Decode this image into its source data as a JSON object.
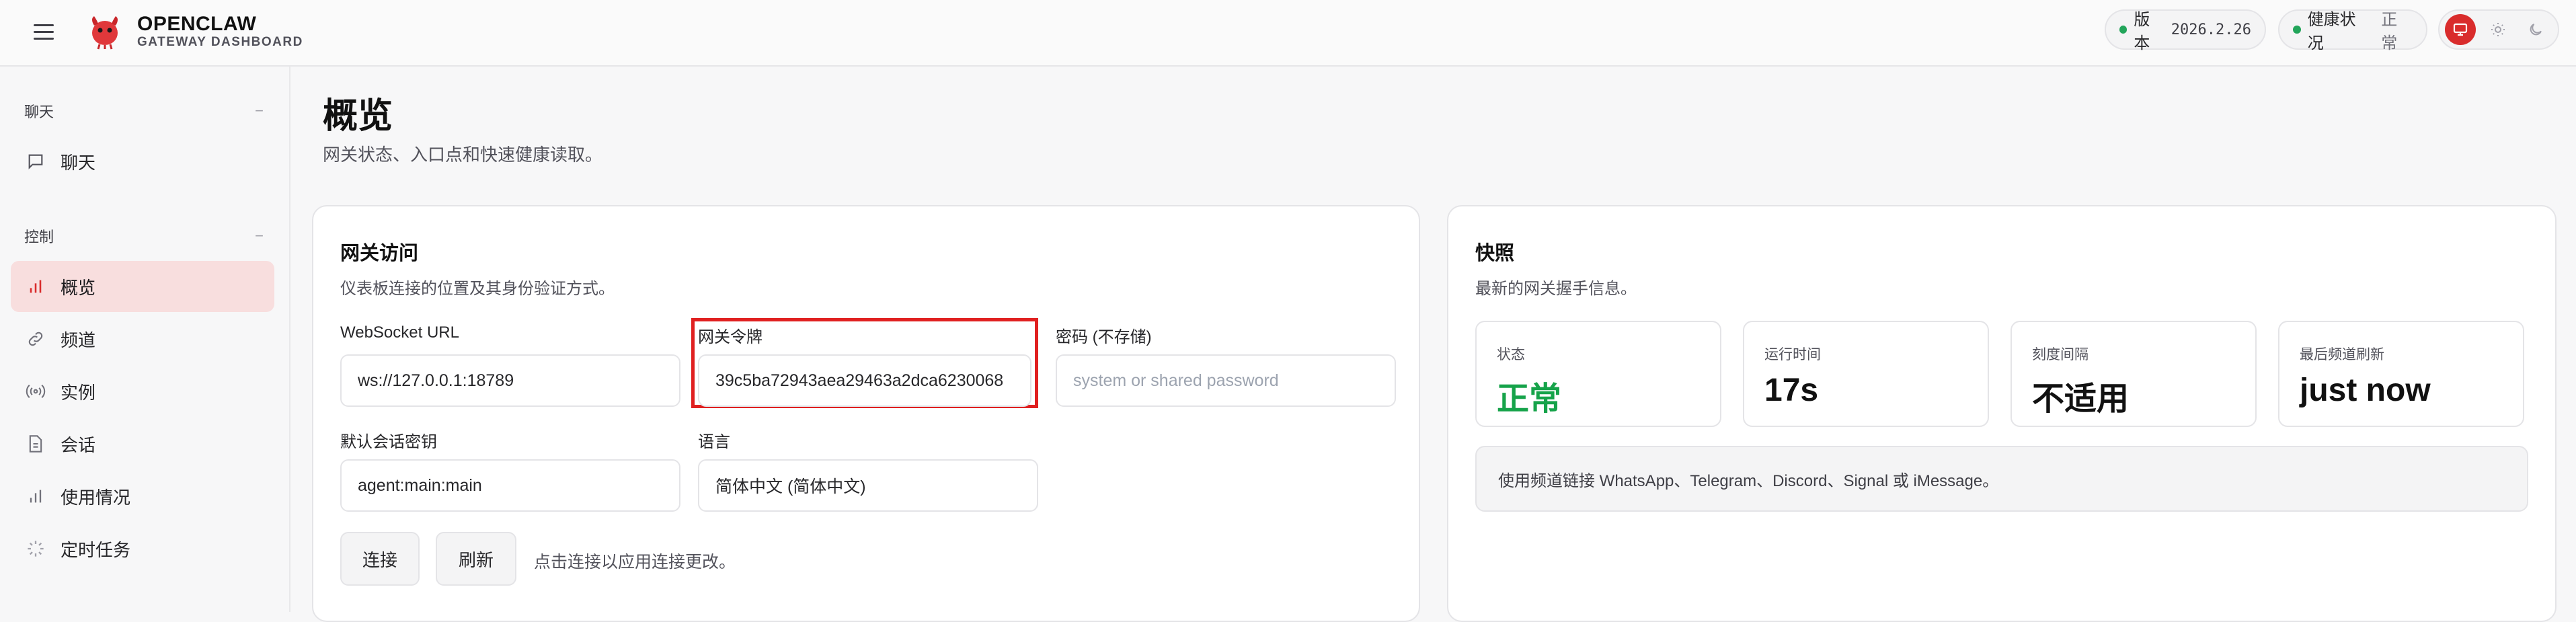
{
  "header": {
    "brand_title": "OPENCLAW",
    "brand_subtitle": "GATEWAY DASHBOARD",
    "version_label": "版本",
    "version_value": "2026.2.26",
    "health_label": "健康状况",
    "health_value": "正常",
    "accent_color": "#d92c2c",
    "status_dot_color": "#22a55a"
  },
  "sidebar": {
    "sections": [
      {
        "label": "聊天",
        "collapse_symbol": "−"
      },
      {
        "label": "控制",
        "collapse_symbol": "−"
      }
    ],
    "items": [
      {
        "label": "聊天",
        "icon": "message-square-icon"
      },
      {
        "label": "概览",
        "icon": "bar-chart-icon",
        "active": true
      },
      {
        "label": "频道",
        "icon": "link-icon"
      },
      {
        "label": "实例",
        "icon": "broadcast-icon"
      },
      {
        "label": "会话",
        "icon": "file-text-icon"
      },
      {
        "label": "使用情况",
        "icon": "bar-chart-icon"
      },
      {
        "label": "定时任务",
        "icon": "loader-icon"
      }
    ]
  },
  "main": {
    "title": "概览",
    "subtitle": "网关状态、入口点和快速健康读取。"
  },
  "gateway_access": {
    "title": "网关访问",
    "description": "仪表板连接的位置及其身份验证方式。",
    "websocket_label": "WebSocket URL",
    "websocket_value": "ws://127.0.0.1:18789",
    "token_label": "网关令牌",
    "token_value": "39c5ba72943aea29463a2dca6230068",
    "password_label": "密码 (不存储)",
    "password_placeholder": "system or shared password",
    "session_key_label": "默认会话密钥",
    "session_key_value": "agent:main:main",
    "language_label": "语言",
    "language_value": "简体中文 (简体中文)",
    "connect_button": "连接",
    "refresh_button": "刷新",
    "hint": "点击连接以应用连接更改。"
  },
  "snapshot": {
    "title": "快照",
    "description": "最新的网关握手信息。",
    "stats": [
      {
        "label": "状态",
        "value": "正常",
        "status_color": "#16a34a"
      },
      {
        "label": "运行时间",
        "value": "17s"
      },
      {
        "label": "刻度间隔",
        "value": "不适用"
      },
      {
        "label": "最后频道刷新",
        "value": "just now"
      }
    ],
    "info": "使用频道链接 WhatsApp、Telegram、Discord、Signal 或 iMessage。"
  }
}
